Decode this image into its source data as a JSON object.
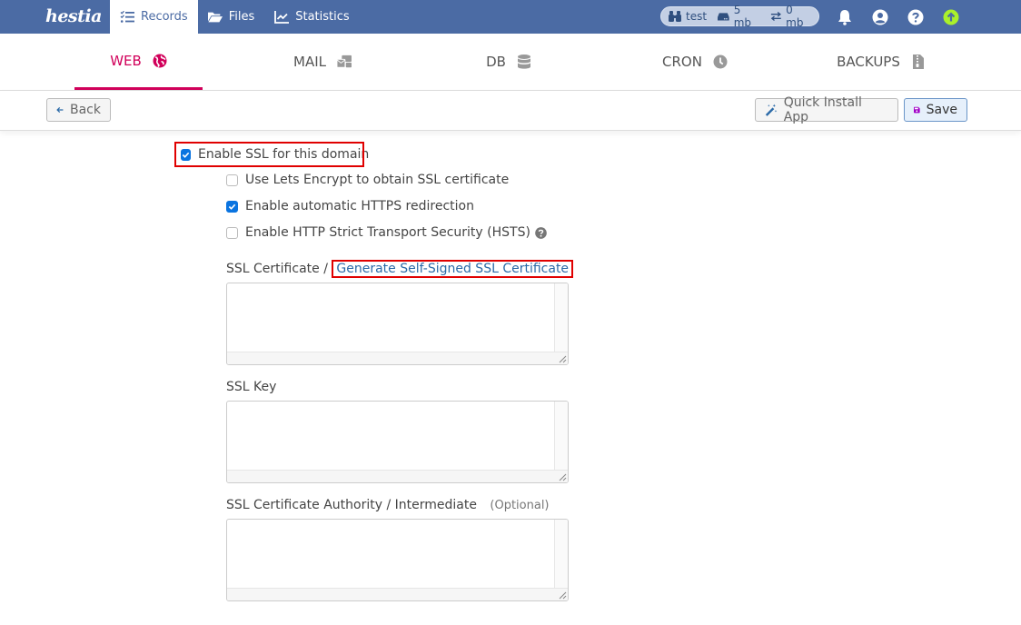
{
  "topbar": {
    "logo": "hestia",
    "nav": [
      {
        "label": "Records",
        "icon": "list-check-icon",
        "active": true
      },
      {
        "label": "Files",
        "icon": "folder-open-icon",
        "active": false
      },
      {
        "label": "Statistics",
        "icon": "chart-line-icon",
        "active": false
      }
    ],
    "usage": {
      "user": "test",
      "disk": "5 mb",
      "bandwidth": "0 mb"
    },
    "icons": [
      "bell-icon",
      "user-circle-icon",
      "question-circle-icon",
      "arrow-up-circle-icon"
    ],
    "colors": {
      "bar": "#4b6ba4",
      "update": "#aaf02a"
    }
  },
  "tabs": [
    {
      "label": "WEB",
      "icon": "globe-icon",
      "active": true
    },
    {
      "label": "MAIL",
      "icon": "mail-bulk-icon",
      "active": false
    },
    {
      "label": "DB",
      "icon": "database-icon",
      "active": false
    },
    {
      "label": "CRON",
      "icon": "clock-icon",
      "active": false
    },
    {
      "label": "BACKUPS",
      "icon": "file-archive-icon",
      "active": false
    }
  ],
  "toolbar": {
    "back_label": "Back",
    "quick_install_label": "Quick Install App",
    "save_label": "Save"
  },
  "form": {
    "enable_ssl": {
      "label": "Enable SSL for this domain",
      "checked": true
    },
    "options": [
      {
        "label": "Use Lets Encrypt to obtain SSL certificate",
        "checked": false
      },
      {
        "label": "Enable automatic HTTPS redirection",
        "checked": true
      },
      {
        "label": "Enable HTTP Strict Transport Security (HSTS)",
        "checked": false
      }
    ],
    "ssl_certificate": {
      "label": "SSL Certificate /",
      "link": "Generate Self-Signed SSL Certificate",
      "value": ""
    },
    "ssl_key": {
      "label": "SSL Key",
      "value": ""
    },
    "ssl_ca": {
      "label": "SSL Certificate Authority / Intermediate",
      "optional": "(Optional)",
      "value": ""
    }
  },
  "accent": "#d1005a"
}
